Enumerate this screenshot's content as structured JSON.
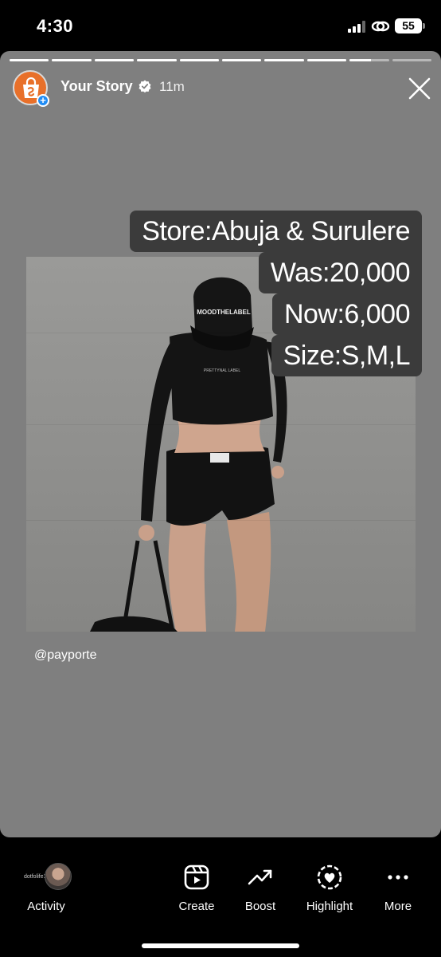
{
  "status_bar": {
    "time": "4:30",
    "battery": "55",
    "icons": [
      "signal-icon",
      "link-icon",
      "battery-icon"
    ]
  },
  "story": {
    "owner": "Your Story",
    "age": "11m",
    "progress": {
      "segments": 10,
      "completed": 8,
      "current_fill": 0.55
    },
    "icons": [
      "shopping-bag-icon",
      "verified-icon",
      "close-icon"
    ],
    "photo": {
      "cap_text": "MOODTHELABEL",
      "top_text": "PRETTYNAL LABEL"
    },
    "price_tag": {
      "store": "Store:Abuja & Surulere",
      "was": "Was:20,000",
      "now": "Now:6,000",
      "size": "Size:S,M,L"
    },
    "mention": "@payporte"
  },
  "bottom_bar": {
    "viewer_name": "dotfolife18",
    "activity_label": "Activity",
    "create_label": "Create",
    "boost_label": "Boost",
    "highlight_label": "Highlight",
    "more_label": "More"
  },
  "colors": {
    "background": "#000000",
    "story_card": "#7f7f7f",
    "price_tag_bg": "#3b3b3b",
    "brand_orange": "#e8702a",
    "badge_blue": "#1f8cf5"
  }
}
